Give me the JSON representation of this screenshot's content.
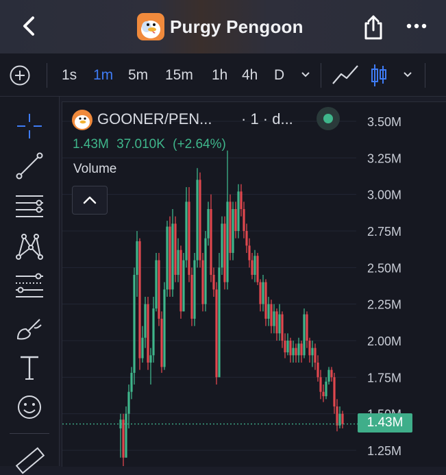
{
  "header": {
    "title": "Purgy Pengoon",
    "icons": [
      "back-chevron",
      "app-logo",
      "share",
      "more"
    ]
  },
  "toolbar": {
    "timeframes": [
      "1s",
      "1m",
      "5m",
      "15m",
      "1h",
      "4h",
      "D"
    ],
    "active_timeframe": "1m",
    "accent": "#3f7cf6"
  },
  "legend": {
    "symbol": "GOONER/PEN...",
    "interval": "· 1 · d...",
    "price": "1.43M",
    "change": "37.010K",
    "change_pct": "(+2.64%)",
    "volume_label": "Volume"
  },
  "price_scale": {
    "labels": [
      "3.50M",
      "3.25M",
      "3.00M",
      "2.75M",
      "2.50M",
      "2.25M",
      "2.00M",
      "1.75M",
      "1.50M",
      "1.25M"
    ],
    "current": "1.43M",
    "colors": {
      "up": "#3fb68b",
      "down": "#e0484e",
      "tag": "#3fae8a"
    }
  },
  "chart_data": {
    "type": "candlestick",
    "yunit": "M",
    "ylim": [
      1.15,
      3.62
    ],
    "last_price": 1.43,
    "ohlc": [
      [
        1.4,
        1.5,
        1.2,
        1.46
      ],
      [
        1.46,
        1.5,
        1.1,
        1.2
      ],
      [
        1.2,
        1.55,
        1.2,
        1.5
      ],
      [
        1.5,
        1.7,
        1.4,
        1.65
      ],
      [
        1.65,
        1.82,
        1.6,
        1.78
      ],
      [
        1.78,
        2.5,
        1.7,
        2.45
      ],
      [
        2.45,
        2.75,
        2.3,
        2.68
      ],
      [
        2.68,
        2.7,
        1.8,
        1.88
      ],
      [
        1.88,
        2.1,
        1.85,
        2.02
      ],
      [
        2.02,
        2.3,
        1.95,
        2.25
      ],
      [
        2.25,
        2.3,
        1.8,
        1.85
      ],
      [
        1.85,
        1.95,
        1.7,
        1.9
      ],
      [
        1.9,
        2.3,
        1.85,
        2.22
      ],
      [
        2.22,
        2.6,
        2.2,
        2.55
      ],
      [
        2.55,
        2.6,
        2.1,
        2.15
      ],
      [
        2.15,
        2.2,
        1.78,
        1.82
      ],
      [
        1.82,
        2.4,
        1.8,
        2.35
      ],
      [
        2.35,
        2.82,
        2.3,
        2.78
      ],
      [
        2.78,
        2.85,
        2.3,
        2.35
      ],
      [
        2.35,
        2.9,
        2.3,
        2.8
      ],
      [
        2.8,
        2.85,
        2.4,
        2.45
      ],
      [
        2.45,
        2.7,
        2.4,
        2.62
      ],
      [
        2.62,
        2.65,
        2.15,
        2.2
      ],
      [
        2.2,
        2.6,
        2.2,
        2.55
      ],
      [
        2.55,
        3.05,
        2.5,
        2.95
      ],
      [
        2.95,
        3.05,
        2.4,
        2.45
      ],
      [
        2.45,
        2.5,
        2.1,
        2.15
      ],
      [
        2.15,
        2.6,
        2.1,
        2.55
      ],
      [
        2.55,
        3.18,
        2.5,
        3.1
      ],
      [
        3.1,
        3.15,
        2.5,
        2.55
      ],
      [
        2.55,
        2.6,
        2.2,
        2.25
      ],
      [
        2.25,
        2.75,
        2.2,
        2.7
      ],
      [
        2.7,
        2.95,
        2.65,
        2.9
      ],
      [
        2.9,
        3.0,
        2.4,
        2.45
      ],
      [
        2.45,
        2.5,
        2.3,
        2.35
      ],
      [
        2.35,
        2.4,
        1.7,
        1.75
      ],
      [
        1.75,
        2.6,
        1.75,
        2.5
      ],
      [
        2.5,
        2.85,
        2.45,
        2.8
      ],
      [
        2.8,
        2.85,
        2.35,
        2.4
      ],
      [
        2.4,
        3.3,
        2.35,
        2.95
      ],
      [
        2.95,
        3.0,
        2.55,
        2.6
      ],
      [
        2.6,
        2.95,
        2.55,
        2.9
      ],
      [
        2.9,
        2.95,
        2.7,
        2.75
      ],
      [
        2.75,
        3.07,
        2.7,
        3.02
      ],
      [
        3.02,
        3.07,
        2.85,
        2.9
      ],
      [
        2.9,
        2.95,
        2.7,
        2.75
      ],
      [
        2.75,
        2.8,
        2.6,
        2.65
      ],
      [
        2.65,
        2.7,
        2.5,
        2.55
      ],
      [
        2.55,
        2.6,
        2.42,
        2.45
      ],
      [
        2.45,
        2.62,
        2.4,
        2.58
      ],
      [
        2.58,
        2.6,
        2.38,
        2.4
      ],
      [
        2.4,
        2.42,
        2.2,
        2.25
      ],
      [
        2.25,
        2.45,
        2.2,
        2.4
      ],
      [
        2.4,
        2.42,
        2.1,
        2.15
      ],
      [
        2.15,
        2.3,
        2.1,
        2.25
      ],
      [
        2.25,
        2.28,
        2.05,
        2.1
      ],
      [
        2.1,
        2.25,
        2.05,
        2.2
      ],
      [
        2.2,
        2.22,
        2.0,
        2.05
      ],
      [
        2.05,
        2.25,
        2.0,
        2.18
      ],
      [
        2.18,
        2.2,
        1.95,
        2.0
      ],
      [
        2.0,
        2.05,
        1.88,
        1.92
      ],
      [
        1.92,
        2.05,
        1.9,
        2.0
      ],
      [
        2.0,
        2.02,
        1.85,
        1.9
      ],
      [
        1.9,
        2.0,
        1.85,
        1.95
      ],
      [
        1.95,
        1.98,
        1.85,
        1.9
      ],
      [
        1.9,
        2.02,
        1.85,
        1.98
      ],
      [
        1.98,
        2.0,
        1.85,
        1.9
      ],
      [
        1.9,
        2.22,
        1.88,
        2.18
      ],
      [
        2.18,
        2.2,
        1.95,
        2.0
      ],
      [
        2.0,
        2.02,
        1.85,
        1.9
      ],
      [
        1.9,
        2.0,
        1.82,
        1.95
      ],
      [
        1.95,
        1.98,
        1.8,
        1.85
      ],
      [
        1.85,
        1.9,
        1.72,
        1.75
      ],
      [
        1.75,
        1.8,
        1.6,
        1.65
      ],
      [
        1.65,
        1.7,
        1.58,
        1.62
      ],
      [
        1.62,
        1.75,
        1.6,
        1.72
      ],
      [
        1.72,
        1.82,
        1.7,
        1.8
      ],
      [
        1.8,
        1.82,
        1.72,
        1.75
      ],
      [
        1.75,
        1.78,
        1.5,
        1.55
      ],
      [
        1.55,
        1.6,
        1.38,
        1.42
      ],
      [
        1.42,
        1.55,
        1.4,
        1.5
      ],
      [
        1.5,
        1.52,
        1.4,
        1.43
      ]
    ]
  }
}
